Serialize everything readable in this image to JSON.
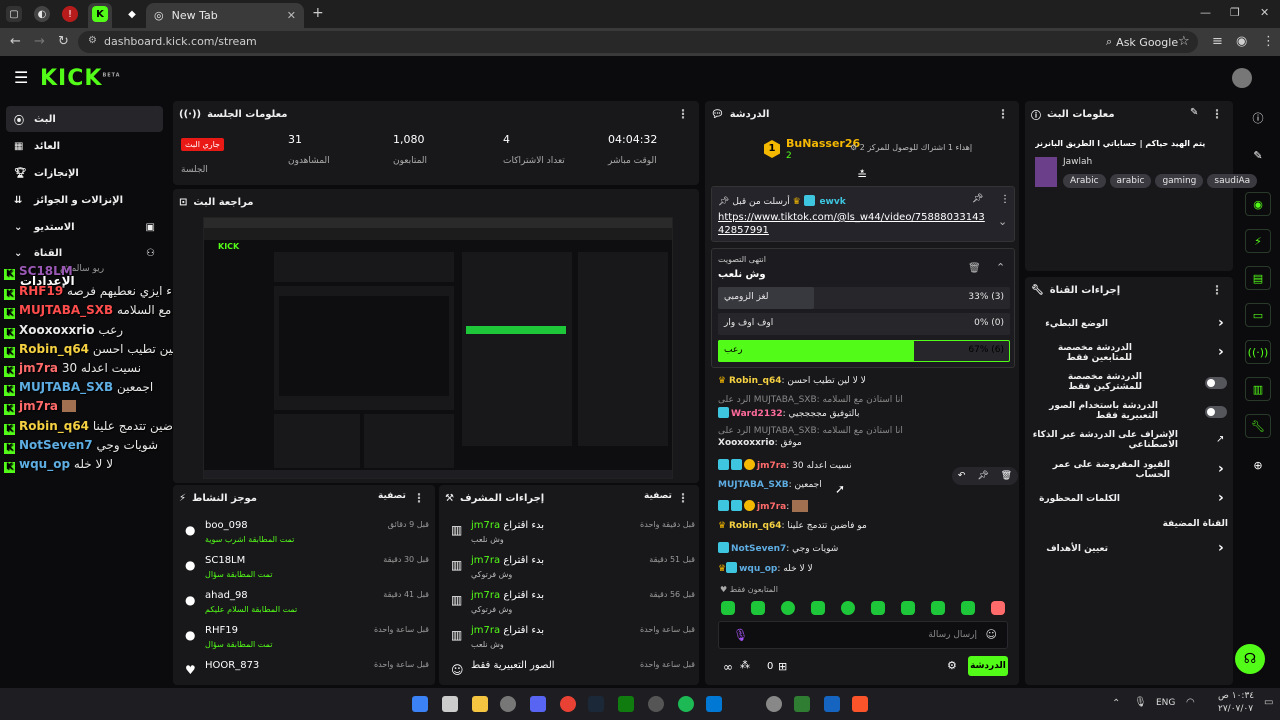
{
  "browser": {
    "tab_title": "New Tab",
    "url": "dashboard.kick.com/stream",
    "ask_google": "Ask Google"
  },
  "app": {
    "logo": "KICK",
    "logo_beta": "BETA"
  },
  "sidebar": {
    "items": [
      {
        "label": "البث"
      },
      {
        "label": "العائد"
      },
      {
        "label": "الإنجازات"
      },
      {
        "label": "الإنزالات و الجوائز"
      },
      {
        "label": "الاستديو"
      },
      {
        "label": "القناة"
      },
      {
        "label": "الإعدادات"
      }
    ],
    "partial": "ريو سالمش"
  },
  "overlay_chat": [
    {
      "user": "SC18LM",
      "msg": "",
      "color": "#9b59b6"
    },
    {
      "user": "",
      "msg": "الإعدادات",
      "color": "#ffffff"
    },
    {
      "user": "RHF19",
      "msg": "جود حي عينك ماقصرتي وكيمي ماقصرتو اخذا فوز في اشياء اصعب هذي اشياء ايزي نعطيهم فرصه",
      "color": "#e8e8e8"
    },
    {
      "user": "MUJTABA_SXB",
      "msg": "انا استاذن مع السلامه",
      "color": "#ff4d4d"
    },
    {
      "user": "Xooxoxxrio",
      "msg": "رعب",
      "color": "#e8e8e8"
    },
    {
      "user": "Robin_q64",
      "msg": "لا لا لين تطيب احسن",
      "color": "#f5d142"
    },
    {
      "user": "jm7ra",
      "msg": "نسيت اعدله 30",
      "color": "#ff6b6b"
    },
    {
      "user": "MUJTABA_SXB",
      "msg": "اجمعين",
      "color": "#5dade2"
    },
    {
      "user": "jm7ra",
      "msg": "",
      "color": "#ff6b6b"
    },
    {
      "user": "Robin_q64",
      "msg": "مو فاضين تتدمج علينا",
      "color": "#f5d142"
    },
    {
      "user": "NotSeven7",
      "msg": "شويات وجي",
      "color": "#5dade2"
    },
    {
      "user": "wqu_op",
      "msg": "لا لا خله",
      "color": "#5dade2"
    }
  ],
  "session": {
    "title": "معلومات الجلسة",
    "live_badge": "جاري البث",
    "session_label": "الجلسة",
    "stats": [
      {
        "value": "04:04:32",
        "label": "الوقت مباشر"
      },
      {
        "value": "4",
        "label": "تعداد الاشتراكات"
      },
      {
        "value": "1,080",
        "label": "المتابعون"
      },
      {
        "value": "31",
        "label": "المشاهدون"
      }
    ]
  },
  "preview": {
    "title": "مراجعة البث"
  },
  "activity": {
    "title": "موجز النشاط",
    "filter": "تصفية",
    "rows": [
      {
        "name": "boo_098",
        "sub": "تمت المطابقة اشرب سوية",
        "time": "قبل 9 دقائق"
      },
      {
        "name": "SC18LM",
        "sub": "تمت المطابقة سؤال",
        "time": "قبل 30 دقيقة"
      },
      {
        "name": "ahad_98",
        "sub": "تمت المطابقة السلام عليكم",
        "time": "قبل 41 دقيقة"
      },
      {
        "name": "RHF19",
        "sub": "تمت المطابقة سؤال",
        "time": "قبل ساعة واحدة"
      },
      {
        "name": "HOOR_873",
        "sub": "",
        "time": "قبل ساعة واحدة"
      }
    ]
  },
  "mod_actions": {
    "title": "إجراءات المشرف",
    "filter": "تصفية",
    "rows": [
      {
        "name": "jm7ra",
        "action": "بدء اقتراع",
        "sub": "وش نلعب",
        "time": "قبل دقيقة واحدة"
      },
      {
        "name": "jm7ra",
        "action": "بدء اقتراع",
        "sub": "وش فرتوكي",
        "time": "قبل 51 دقيقة"
      },
      {
        "name": "jm7ra",
        "action": "بدء اقتراع",
        "sub": "وش فرتوكي",
        "time": "قبل 56 دقيقة"
      },
      {
        "name": "jm7ra",
        "action": "بدء اقتراع",
        "sub": "وش نلعب",
        "time": "قبل ساعة واحدة"
      },
      {
        "name": "",
        "action": "الصور التعبيرية فقط",
        "sub": "",
        "time": "قبل ساعة واحدة"
      }
    ]
  },
  "chat": {
    "title": "الدردشة",
    "top_user": "BuNasser26",
    "top_count": "2",
    "top_rank": "1",
    "top_message": "إهداء 1 اشتراك للوصول للمركز 2",
    "pinned_by_label": "أرسلت من قبل",
    "pinned_by": "ewvk",
    "pinned_url": "https://www.tiktok.com/@ls_w44/video/7588803314342857991",
    "poll": {
      "status": "انتهى التصويت",
      "question": "وش نلعب",
      "options": [
        {
          "label": "لغز الزومبي",
          "pct": "33% (3)",
          "fill": 0.33
        },
        {
          "label": "اوف اوف وار",
          "pct": "0% (0)",
          "fill": 0.0
        },
        {
          "label": "رعب",
          "pct": "67% (6)",
          "fill": 0.67
        }
      ]
    },
    "messages": [
      {
        "user": "Robin_q64",
        "msg": "لا لا لين تطيب احسن",
        "color": "#f5d142"
      },
      {
        "user": "",
        "msg": "الرد على MUJTABA_SXB: انا استاذن مع السلامه",
        "color": "#888888"
      },
      {
        "user": "Ward2132",
        "msg": "بالتوفيق مججججيي",
        "color": "#ff6b9a"
      },
      {
        "user": "",
        "msg": "الرد على MUJTABA_SXB: انا استاذن مع السلامه",
        "color": "#888888"
      },
      {
        "user": "Xooxoxxrio",
        "msg": "موفق",
        "color": "#e8e8e8"
      },
      {
        "user": "jm7ra",
        "msg": "نسيت اعدله 30",
        "color": "#ff6b6b"
      },
      {
        "user": "MUJTABA_SXB",
        "msg": "اجمعين",
        "color": "#5dade2"
      },
      {
        "user": "jm7ra",
        "msg": "",
        "color": "#ff6b6b"
      },
      {
        "user": "Robin_q64",
        "msg": "مو فاضين تتدمج علينا",
        "color": "#f5d142"
      },
      {
        "user": "NotSeven7",
        "msg": "شويات وجي",
        "color": "#5dade2"
      },
      {
        "user": "wqu_op",
        "msg": "لا لا خله",
        "color": "#5dade2"
      }
    ],
    "followers_only": "المتابعون فقط",
    "input_placeholder": "إرسال رسالة",
    "send_label": "الدردشة",
    "points": "0"
  },
  "stream_info": {
    "title": "معلومات البث",
    "stream_title": "يتم الهيد حياكم | حساباتي ا الطريق البانرنر",
    "category": "Jawlah",
    "tags": [
      "Arabic",
      "arabic",
      "gaming",
      "saudiAa"
    ]
  },
  "channel_actions": {
    "title": "إجراءات القناة",
    "items": [
      {
        "label": "الوضع البطيء",
        "kind": "chevron"
      },
      {
        "label": "الدردشة مخصصة للمتابعين فقط",
        "kind": "chevron"
      },
      {
        "label": "الدردشة مخصصة للمشتركين فقط",
        "kind": "toggle"
      },
      {
        "label": "الدردشة باستخدام الصور التعبيرية فقط",
        "kind": "toggle"
      },
      {
        "label": "الإشراف على الدردشة عبر الذكاء الاصطناعي",
        "kind": "external"
      },
      {
        "label": "القيود المفروضة على عمر الحساب",
        "kind": "chevron"
      },
      {
        "label": "الكلمات المحظورة",
        "kind": "chevron"
      },
      {
        "label": "القناة المضيفة",
        "kind": "none"
      },
      {
        "label": "تعيين الأهداف",
        "kind": "chevron"
      }
    ]
  },
  "taskbar": {
    "lang": "ENG",
    "time": "١٠:٣٤ ص",
    "date": "٢٧/٠٧/٠٧"
  },
  "colors": {
    "accent": "#53fc18",
    "panel": "#18181b",
    "live": "#e91916"
  }
}
